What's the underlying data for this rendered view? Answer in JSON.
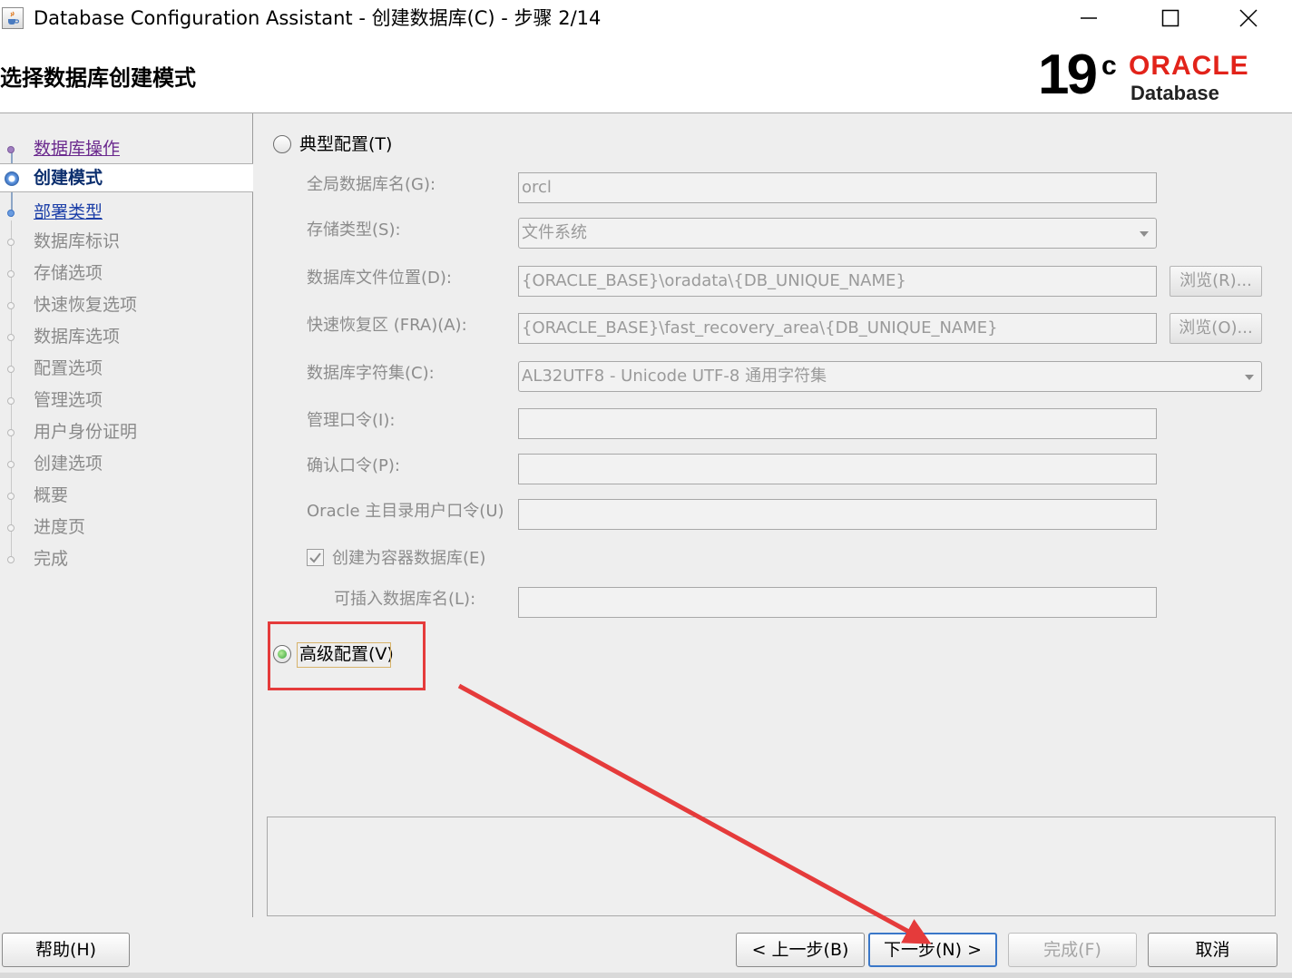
{
  "window": {
    "title": "Database Configuration Assistant - 创建数据库(C) - 步骤 2/14",
    "icon": "java-cup-icon",
    "controls": [
      "minimize-icon",
      "maximize-icon",
      "close-icon"
    ]
  },
  "header": {
    "title": "选择数据库创建模式",
    "logo": {
      "version": "19",
      "version_suffix": "c",
      "brand": "ORACLE",
      "product": "Database",
      "brand_color": "#e2231a"
    }
  },
  "nav": {
    "items": [
      {
        "label": "数据库操作",
        "state": "visited"
      },
      {
        "label": "创建模式",
        "state": "current"
      },
      {
        "label": "部署类型",
        "state": "link"
      },
      {
        "label": "数据库标识",
        "state": "disabled"
      },
      {
        "label": "存储选项",
        "state": "disabled"
      },
      {
        "label": "快速恢复选项",
        "state": "disabled"
      },
      {
        "label": "数据库选项",
        "state": "disabled"
      },
      {
        "label": "配置选项",
        "state": "disabled"
      },
      {
        "label": "管理选项",
        "state": "disabled"
      },
      {
        "label": "用户身份证明",
        "state": "disabled"
      },
      {
        "label": "创建选项",
        "state": "disabled"
      },
      {
        "label": "概要",
        "state": "disabled"
      },
      {
        "label": "进度页",
        "state": "disabled"
      },
      {
        "label": "完成",
        "state": "disabled"
      }
    ]
  },
  "main": {
    "typical": {
      "label": "典型配置(T)",
      "selected": false,
      "global_db_name": {
        "label": "全局数据库名(G):",
        "value": "orcl"
      },
      "storage_type": {
        "label": "存储类型(S):",
        "value": "文件系统"
      },
      "db_file_location": {
        "label": "数据库文件位置(D):",
        "value": "{ORACLE_BASE}\\oradata\\{DB_UNIQUE_NAME}",
        "browse": "浏览(R)..."
      },
      "fra": {
        "label": "快速恢复区 (FRA)(A):",
        "value": "{ORACLE_BASE}\\fast_recovery_area\\{DB_UNIQUE_NAME}",
        "browse": "浏览(O)..."
      },
      "charset": {
        "label": "数据库字符集(C):",
        "value": "AL32UTF8 - Unicode UTF-8 通用字符集"
      },
      "admin_password": {
        "label": "管理口令(I):",
        "value": ""
      },
      "confirm_password": {
        "label": "确认口令(P):",
        "value": ""
      },
      "oracle_home_password": {
        "label": "Oracle 主目录用户口令(U)",
        "value": ""
      },
      "container_db": {
        "label": "创建为容器数据库(E)",
        "checked": true
      },
      "pdb_name": {
        "label": "可插入数据库名(L):",
        "value": ""
      }
    },
    "advanced": {
      "label": "高级配置(V)",
      "selected": true
    }
  },
  "buttons": {
    "help": "帮助(H)",
    "back": "< 上一步(B)",
    "next": "下一步(N) >",
    "finish": "完成(F)",
    "cancel": "取消"
  },
  "annotations": {
    "highlight_color": "#e53b3b",
    "highlight_target": "高级配置(V)",
    "arrow_target": "下一步(N) >"
  }
}
